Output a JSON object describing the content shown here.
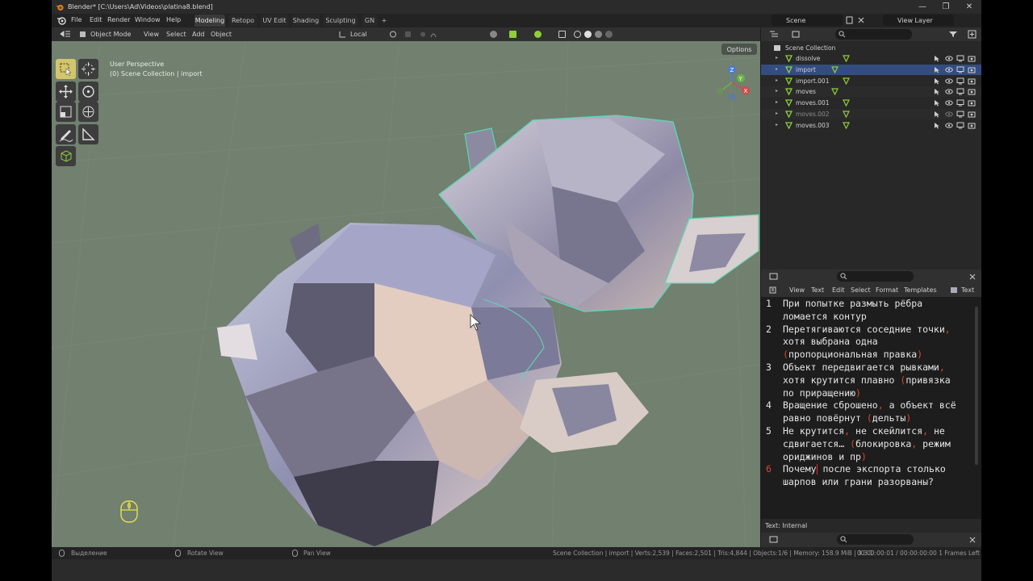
{
  "window": {
    "title": "Blender* [C:\\Users\\Ad\\Videos\\platina8.blend]",
    "controls": [
      "—",
      "❐",
      "✕"
    ]
  },
  "menu": {
    "items": [
      "File",
      "Edit",
      "Render",
      "Window",
      "Help"
    ]
  },
  "workspace_tabs": [
    "Modeling",
    "Retopo",
    "UV Edit",
    "Shading",
    "Sculpting",
    "GN",
    "+"
  ],
  "active_workspace": "Modeling",
  "scene_selector": {
    "scene": "Scene",
    "view_layer": "View Layer"
  },
  "viewport_header": {
    "mode": "Object Mode",
    "menus": [
      "View",
      "Select",
      "Add",
      "Object"
    ],
    "orientation": "Local"
  },
  "viewport": {
    "perspective_label": "User Perspective",
    "collection_label": "(0) Scene Collection | import",
    "options_label": "Options",
    "gizmo_axes": [
      "Z",
      "Y",
      "X"
    ],
    "background_color": "#71806f"
  },
  "outliner": {
    "root": "Scene Collection",
    "items": [
      {
        "name": "dissolve",
        "selected": false,
        "hidden": false
      },
      {
        "name": "import",
        "selected": true,
        "hidden": false
      },
      {
        "name": "import.001",
        "selected": false,
        "hidden": false
      },
      {
        "name": "moves",
        "selected": false,
        "hidden": false
      },
      {
        "name": "moves.001",
        "selected": false,
        "hidden": false
      },
      {
        "name": "moves.002",
        "selected": false,
        "hidden": true
      },
      {
        "name": "moves.003",
        "selected": false,
        "hidden": false
      }
    ]
  },
  "text_editor": {
    "menus": [
      "View",
      "Text",
      "Edit",
      "Select",
      "Format",
      "Templates"
    ],
    "tab_label": "Text",
    "footer": "Text: Internal",
    "lines": [
      {
        "num": "1",
        "segments": [
          [
            "При попытке размыть рёбра",
            false
          ]
        ]
      },
      {
        "num": "",
        "segments": [
          [
            "ломается контур",
            false
          ]
        ]
      },
      {
        "num": "2",
        "segments": [
          [
            "Перетягиваются соседние точки",
            false
          ],
          [
            ",",
            true
          ]
        ]
      },
      {
        "num": "",
        "segments": [
          [
            "хотя выбрана одна",
            false
          ]
        ]
      },
      {
        "num": "",
        "segments": [
          [
            "(",
            true
          ],
          [
            "пропорциональная правка",
            false
          ],
          [
            ")",
            true
          ]
        ]
      },
      {
        "num": "3",
        "segments": [
          [
            "Объект передвигается рывками",
            false
          ],
          [
            ",",
            true
          ]
        ]
      },
      {
        "num": "",
        "segments": [
          [
            "хотя крутится плавно ",
            false
          ],
          [
            "(",
            true
          ],
          [
            "привязка",
            false
          ]
        ]
      },
      {
        "num": "",
        "segments": [
          [
            "по приращению",
            false
          ],
          [
            ")",
            true
          ]
        ]
      },
      {
        "num": "4",
        "segments": [
          [
            "Вращение сброшено",
            false
          ],
          [
            ",",
            true
          ],
          [
            " а объект всё",
            false
          ]
        ]
      },
      {
        "num": "",
        "segments": [
          [
            "равно повёрнут ",
            false
          ],
          [
            "(",
            true
          ],
          [
            "дельты",
            false
          ],
          [
            ")",
            true
          ]
        ]
      },
      {
        "num": "5",
        "segments": [
          [
            "Не крутится",
            false
          ],
          [
            ",",
            true
          ],
          [
            " не скейлится",
            false
          ],
          [
            ",",
            true
          ],
          [
            " не",
            false
          ]
        ]
      },
      {
        "num": "",
        "segments": [
          [
            "сдвигается",
            false
          ],
          [
            "…",
            false
          ],
          [
            " ",
            false
          ],
          [
            "(",
            true
          ],
          [
            "блокировка",
            false
          ],
          [
            ",",
            true
          ],
          [
            " режим",
            false
          ]
        ]
      },
      {
        "num": "",
        "segments": [
          [
            "ориджинов и пр",
            false
          ],
          [
            ")",
            true
          ]
        ]
      },
      {
        "num": "6",
        "current": true,
        "segments": [
          [
            "Почему",
            false
          ],
          [
            "|CURSOR|",
            false
          ],
          [
            " после экспорта столько",
            false
          ]
        ]
      },
      {
        "num": "",
        "segments": [
          [
            "шарпов или грани разорваны?",
            false
          ]
        ]
      }
    ]
  },
  "status_bar": {
    "left_hints": [
      "Выделение",
      "Rotate View",
      "Pan View"
    ],
    "stats": "Scene Collection | import | Verts:2,539 | Faces:2,501 | Tris:4,844 | Objects:1/6 | Memory: 158.9 MiB | 3.3.1",
    "timer": "00:00:00:01 / 00:00:00:00  1 Frames Left"
  },
  "colors": {
    "accent_select": "#334d80",
    "active_tool": "#d3c56a",
    "punctuation": "#d9482e",
    "mesh_icon": "#8fcf3a"
  }
}
